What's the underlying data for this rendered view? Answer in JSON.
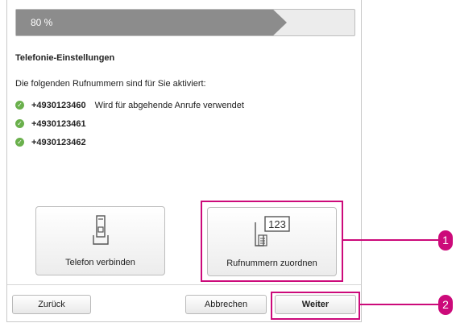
{
  "progress": {
    "value": 0.8,
    "label": "80 %"
  },
  "section_title": "Telefonie-Einstellungen",
  "intro_text": "Die folgenden Rufnummern sind für Sie aktiviert:",
  "numbers": [
    {
      "number": "+4930123460",
      "note": "Wird für abgehende Anrufe verwendet"
    },
    {
      "number": "+4930123461",
      "note": ""
    },
    {
      "number": "+4930123462",
      "note": ""
    }
  ],
  "tiles": {
    "connect_label": "Telefon verbinden",
    "assign_label": "Rufnummern zuordnen",
    "assign_icon_text": "123"
  },
  "footer": {
    "back_label": "Zurück",
    "cancel_label": "Abbrechen",
    "next_label": "Weiter"
  },
  "callouts": {
    "badge1": "1",
    "badge2": "2"
  },
  "colors": {
    "accent": "#cc0a7a",
    "check": "#6ab04c",
    "progress_fill": "#8c8c8c"
  },
  "icons": {
    "connect": "phone-icon",
    "assign": "number-assign-icon",
    "status": "check-icon"
  }
}
